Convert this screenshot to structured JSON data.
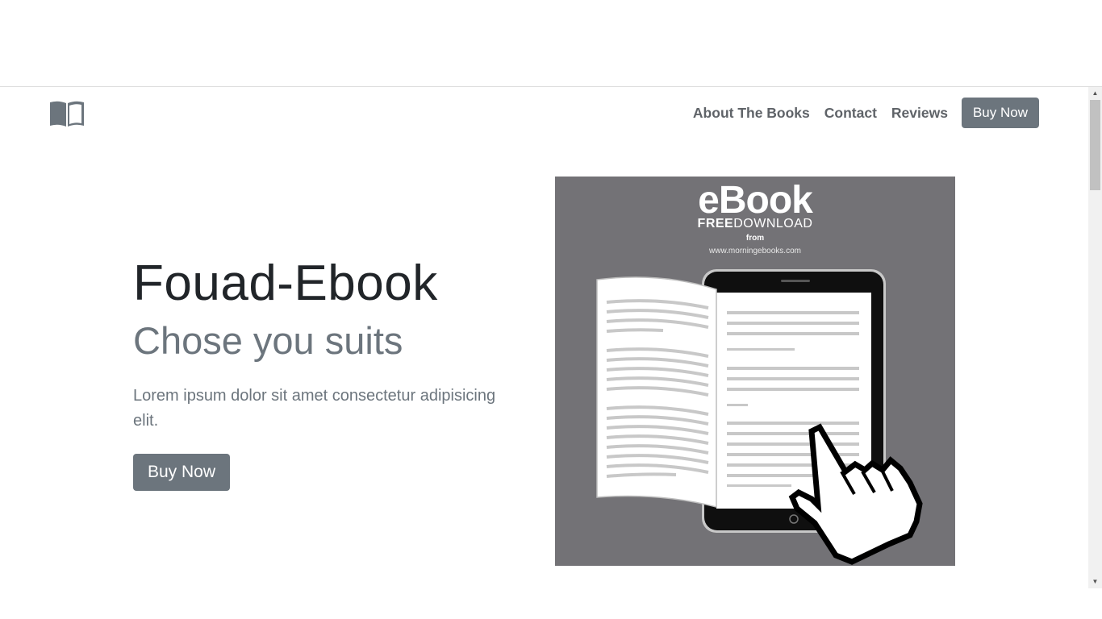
{
  "nav": {
    "links": [
      "About The Books",
      "Contact",
      "Reviews"
    ],
    "cta": "Buy Now"
  },
  "hero": {
    "title": "Fouad-Ebook",
    "subtitle": "Chose you suits",
    "text": "Lorem ipsum dolor sit amet consectetur adipisicing elit.",
    "button": "Buy Now"
  },
  "image": {
    "title": "eBook",
    "sub_bold": "FREE",
    "sub_rest": "DOWNLOAD",
    "from": "from",
    "url": "www.morningebooks.com"
  },
  "icons": {
    "logo": "book-open-icon",
    "pointer": "hand-pointer-icon"
  },
  "colors": {
    "accent": "#6c757d",
    "image_bg": "#737276"
  }
}
